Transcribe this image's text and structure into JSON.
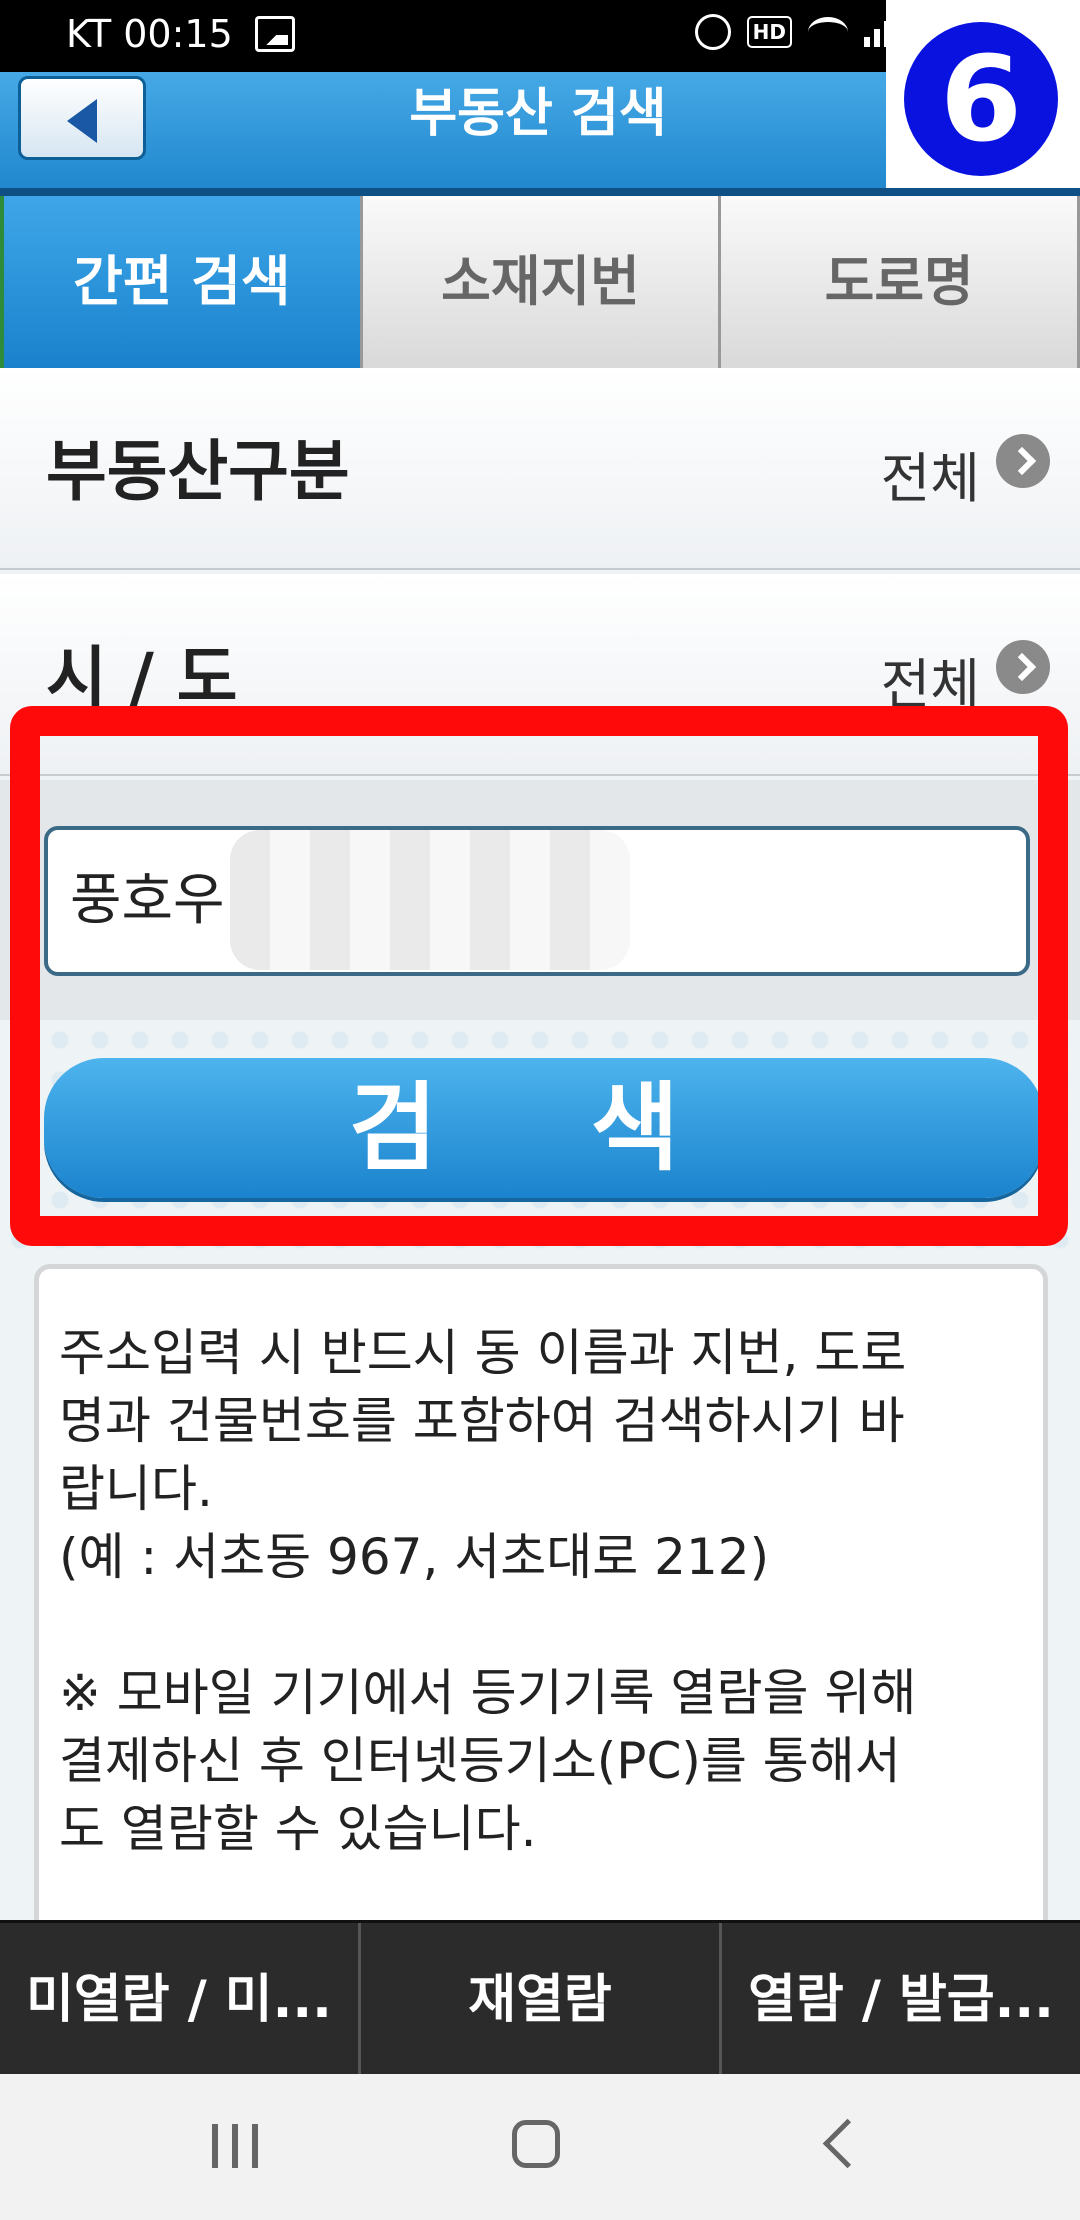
{
  "status_bar": {
    "carrier_time": "KT 00:15",
    "hd_label": "HD"
  },
  "badge": {
    "number": "6"
  },
  "header": {
    "title": "부동산 검색"
  },
  "tabs": [
    {
      "label": "간편 검색",
      "active": true
    },
    {
      "label": "소재지번",
      "active": false
    },
    {
      "label": "도로명",
      "active": false
    }
  ],
  "filters": [
    {
      "label": "부동산구분",
      "value": "전체"
    },
    {
      "label": "시 / 도",
      "value": "전체"
    }
  ],
  "search": {
    "input_value": "풍호우",
    "button_label": "검 색"
  },
  "notice": {
    "paragraph1": [
      "주소입력 시 반드시 동 이름과 지번, 도로",
      "명과 건물번호를 포함하여 검색하시기 바",
      "랍니다.",
      "(예 : 서초동 967, 서초대로 212)"
    ],
    "paragraph2": [
      "※ 모바일 기기에서 등기기록 열람을 위해",
      "결제하신 후 인터넷등기소(PC)를 통해서",
      "도 열람할 수 있습니다."
    ]
  },
  "toolbar": [
    {
      "label": "미열람 / 미..."
    },
    {
      "label": "재열람"
    },
    {
      "label": "열람 / 발급..."
    }
  ],
  "colors": {
    "highlight": "#ff0a0a",
    "accent": "#1f86cd",
    "badge": "#0a12e0"
  }
}
